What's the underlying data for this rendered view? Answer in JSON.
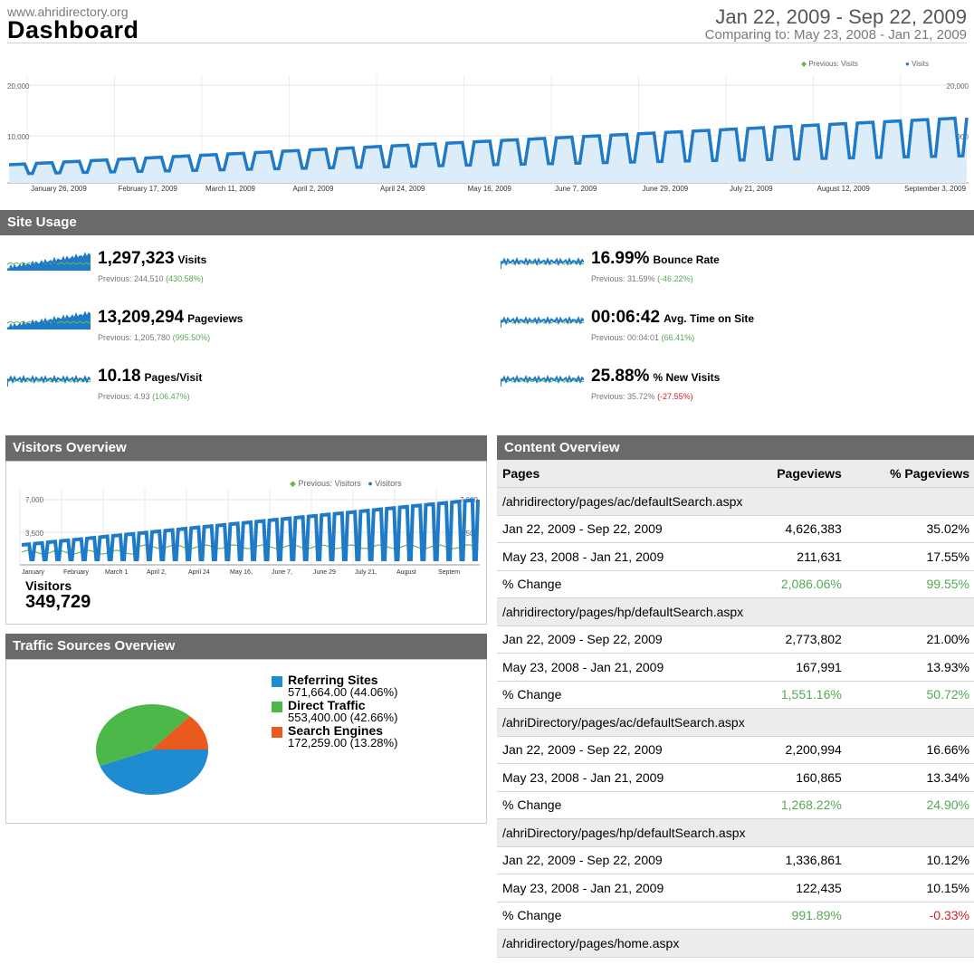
{
  "header": {
    "site_url": "www.ahridirectory.org",
    "title": "Dashboard",
    "date_range": "Jan 22, 2009 - Sep 22, 2009",
    "compare_range": "Comparing to: May 23, 2008 - Jan 21, 2009"
  },
  "main_chart": {
    "legend_previous": "Previous: Visits",
    "legend_current": "Visits",
    "y_max_left": "20,000",
    "y_mid_left": "10,000",
    "y_max_right": "20,000",
    "y_mid_right": "10,000",
    "x_labels": [
      "January 26, 2009",
      "February 17, 2009",
      "March 11, 2009",
      "April 2, 2009",
      "April 24, 2009",
      "May 16, 2009",
      "June 7, 2009",
      "June 29, 2009",
      "July 21, 2009",
      "August 12, 2009",
      "September 3, 2009"
    ],
    "colors": {
      "current": "#1f7ac7",
      "previous": "#66bb44"
    }
  },
  "site_usage": {
    "title": "Site Usage",
    "metrics": [
      {
        "value": "1,297,323",
        "label": "Visits",
        "previous": "Previous: 244,510",
        "change": "(430.58%)",
        "trend": "up"
      },
      {
        "value": "13,209,294",
        "label": "Pageviews",
        "previous": "Previous: 1,205,780",
        "change": "(995.50%)",
        "trend": "up"
      },
      {
        "value": "10.18",
        "label": "Pages/Visit",
        "previous": "Previous: 4.93",
        "change": "(106.47%)",
        "trend": "up"
      },
      {
        "value": "16.99%",
        "label": "Bounce Rate",
        "previous": "Previous: 31.59%",
        "change": "(-46.22%)",
        "trend": "up"
      },
      {
        "value": "00:06:42",
        "label": "Avg. Time on Site",
        "previous": "Previous: 00:04:01",
        "change": "(66.41%)",
        "trend": "up"
      },
      {
        "value": "25.88%",
        "label": "% New Visits",
        "previous": "Previous: 35.72%",
        "change": "(-27.55%)",
        "trend": "down"
      }
    ]
  },
  "visitors_overview": {
    "title": "Visitors Overview",
    "legend_previous": "Previous: Visitors",
    "legend_current": "Visitors",
    "y_max": "7,000",
    "y_mid": "3,500",
    "y_max_right": "7,000",
    "y_mid_right": "3,500",
    "x_labels": [
      "January",
      "February",
      "March 1",
      "April 2,",
      "April 24",
      "May 16,",
      "June 7,",
      "June 29",
      "July 21,",
      "August",
      "Septem"
    ],
    "visitors_label": "Visitors",
    "visitors_value": "349,729"
  },
  "traffic_sources": {
    "title": "Traffic Sources Overview",
    "chart_data": {
      "type": "pie",
      "labels": [
        "Referring Sites",
        "Direct Traffic",
        "Search Engines"
      ],
      "values": [
        571664.0,
        553400.0,
        172259.0
      ],
      "percents": [
        44.06,
        42.66,
        13.28
      ],
      "colors": [
        "#1f8bd1",
        "#4db84a",
        "#e85a1e"
      ]
    },
    "items": [
      {
        "name": "Referring Sites",
        "nums": "571,664.00 (44.06%)"
      },
      {
        "name": "Direct Traffic",
        "nums": "553,400.00 (42.66%)"
      },
      {
        "name": "Search Engines",
        "nums": "172,259.00 (13.28%)"
      }
    ]
  },
  "content_overview": {
    "title": "Content Overview",
    "headers": [
      "Pages",
      "Pageviews",
      "% Pageviews"
    ],
    "pages": [
      {
        "path": "/ahridirectory/pages/ac/defaultSearch.aspx",
        "rows": [
          [
            "Jan 22, 2009 - Sep 22, 2009",
            "4,626,383",
            "35.02%"
          ],
          [
            "May 23, 2008 - Jan 21, 2009",
            "211,631",
            "17.55%"
          ],
          [
            "% Change",
            "2,086.06%",
            "99.55%"
          ]
        ]
      },
      {
        "path": "/ahridirectory/pages/hp/defaultSearch.aspx",
        "rows": [
          [
            "Jan 22, 2009 - Sep 22, 2009",
            "2,773,802",
            "21.00%"
          ],
          [
            "May 23, 2008 - Jan 21, 2009",
            "167,991",
            "13.93%"
          ],
          [
            "% Change",
            "1,551.16%",
            "50.72%"
          ]
        ]
      },
      {
        "path": "/ahriDirectory/pages/ac/defaultSearch.aspx",
        "rows": [
          [
            "Jan 22, 2009 - Sep 22, 2009",
            "2,200,994",
            "16.66%"
          ],
          [
            "May 23, 2008 - Jan 21, 2009",
            "160,865",
            "13.34%"
          ],
          [
            "% Change",
            "1,268.22%",
            "24.90%"
          ]
        ]
      },
      {
        "path": "/ahriDirectory/pages/hp/defaultSearch.aspx",
        "rows": [
          [
            "Jan 22, 2009 - Sep 22, 2009",
            "1,336,861",
            "10.12%"
          ],
          [
            "May 23, 2008 - Jan 21, 2009",
            "122,435",
            "10.15%"
          ],
          [
            "% Change",
            "991.89%",
            "-0.33%"
          ]
        ]
      },
      {
        "path": "/ahridirectory/pages/home.aspx",
        "rows": []
      }
    ]
  }
}
